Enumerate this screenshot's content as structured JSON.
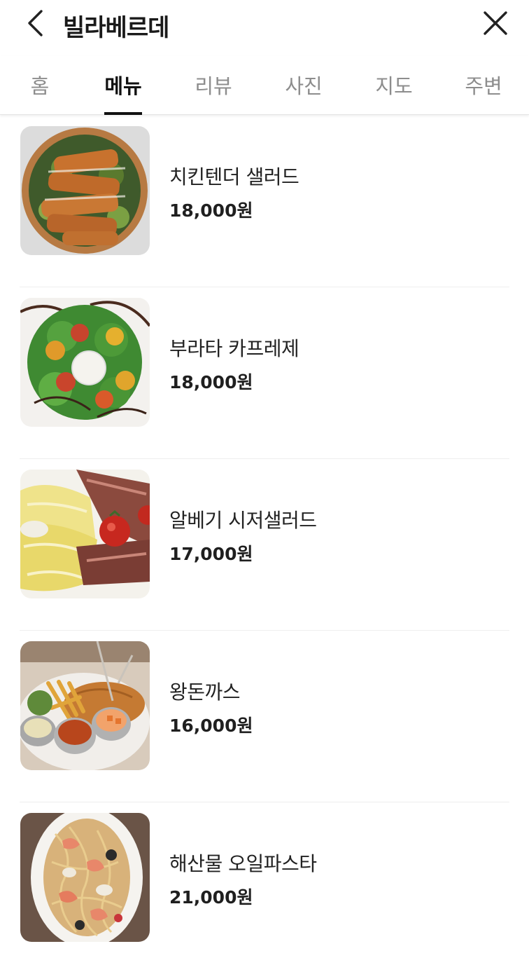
{
  "header": {
    "title": "빌라베르데",
    "back_icon": "chevron-left-icon",
    "close_icon": "close-icon"
  },
  "tabs": [
    {
      "label": "홈",
      "active": false
    },
    {
      "label": "메뉴",
      "active": true
    },
    {
      "label": "리뷰",
      "active": false
    },
    {
      "label": "사진",
      "active": false
    },
    {
      "label": "지도",
      "active": false
    },
    {
      "label": "주변",
      "active": false
    }
  ],
  "menu": [
    {
      "name": "치킨텐더 샐러드",
      "price": "18,000원"
    },
    {
      "name": "부라타 카프레제",
      "price": "18,000원"
    },
    {
      "name": "알베기 시저샐러드",
      "price": "17,000원"
    },
    {
      "name": "왕돈까스",
      "price": "16,000원"
    },
    {
      "name": "해산물 오일파스타",
      "price": "21,000원"
    }
  ]
}
